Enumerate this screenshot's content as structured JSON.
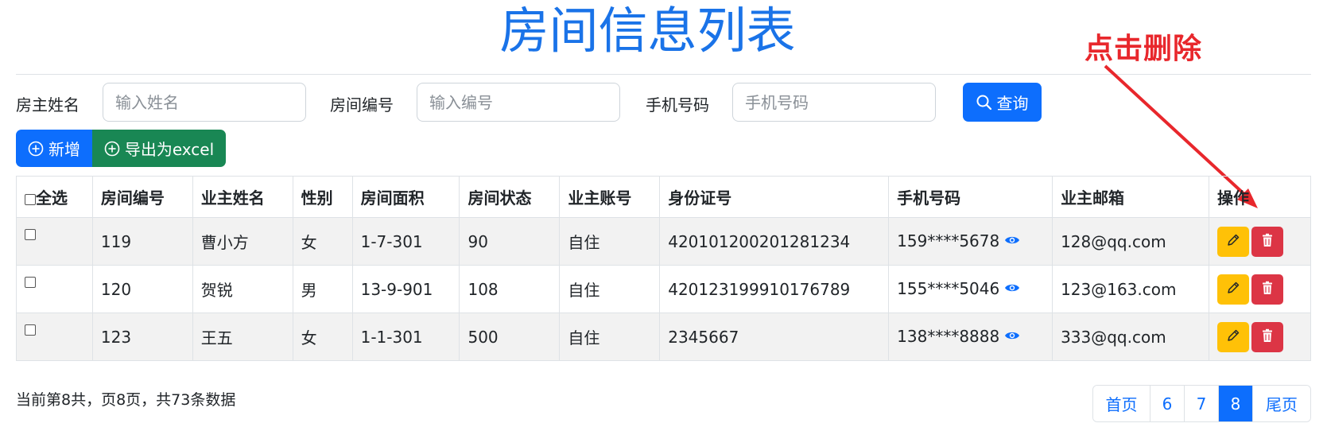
{
  "title": "房间信息列表",
  "annotation": "点击删除",
  "search": {
    "owner_label": "房主姓名",
    "owner_placeholder": "输入姓名",
    "room_label": "房间编号",
    "room_placeholder": "输入编号",
    "phone_label": "手机号码",
    "phone_placeholder": "手机号码",
    "query_button": "查询"
  },
  "toolbar": {
    "add_button": "新增",
    "export_button": "导出为excel"
  },
  "table": {
    "headers": [
      "全选",
      "房间编号",
      "业主姓名",
      "性别",
      "房间面积",
      "房间状态",
      "业主账号",
      "身份证号",
      "手机号码",
      "业主邮箱",
      "操作"
    ],
    "rows": [
      [
        "119",
        "曹小方",
        "女",
        "1-7-301",
        "90",
        "自住",
        "420101200201281234",
        "159****5678",
        "128@qq.com"
      ],
      [
        "120",
        "贺锐",
        "男",
        "13-9-901",
        "108",
        "自住",
        "420123199910176789",
        "155****5046",
        "123@163.com"
      ],
      [
        "123",
        "王五",
        "女",
        "1-1-301",
        "500",
        "自住",
        "2345667",
        "138****8888",
        "333@qq.com"
      ]
    ]
  },
  "footer": {
    "status": "当前第8共，页8页，共73条数据"
  },
  "pagination": {
    "first": "首页",
    "pages": [
      "6",
      "7",
      "8"
    ],
    "active": "8",
    "last": "尾页"
  },
  "colors": {
    "primary": "#0d6efd",
    "success": "#198754",
    "warning": "#ffc107",
    "danger": "#dc3545",
    "title": "#1a73e8",
    "annotation": "#e8272c"
  }
}
